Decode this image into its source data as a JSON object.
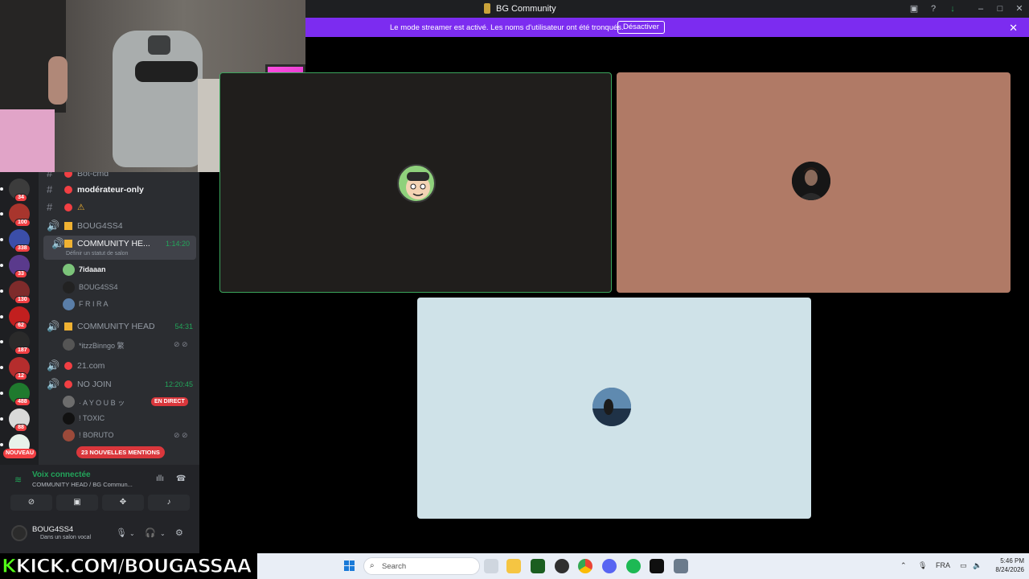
{
  "window": {
    "title": "BG Community"
  },
  "banner": {
    "message": "Le mode streamer est activé. Les noms d'utilisateur ont été tronqués.",
    "action_label": "Désactiver",
    "close_icon": "close-icon",
    "color": "#7c2cf0"
  },
  "servers": [
    {
      "badge": "34",
      "color": "#3c3c3c"
    },
    {
      "badge": "100",
      "color": "#a8352d"
    },
    {
      "badge": "338",
      "color": "#3b4ea8"
    },
    {
      "badge": "33",
      "color": "#5a3a8c"
    },
    {
      "badge": "130",
      "color": "#7e2b2b"
    },
    {
      "badge": "62",
      "color": "#c21f1f"
    },
    {
      "badge": "187",
      "color": "#2a2a2a"
    },
    {
      "badge": "12",
      "color": "#b52d2d"
    },
    {
      "badge": "488",
      "color": "#1f7a2e"
    },
    {
      "badge": "88",
      "color": "#d9d9d9"
    },
    {
      "badge": "",
      "color": "#e8f2ea"
    }
  ],
  "servers_new_label": "NOUVEAU",
  "channels": {
    "items": [
      {
        "name": "Bot-cmd",
        "icon": "hash"
      },
      {
        "name": "modérateur-only",
        "icon": "hash"
      },
      {
        "name": "⚠",
        "icon": "hash"
      },
      {
        "name": "BOUG4SS4",
        "icon": "speaker"
      },
      {
        "name": "COMMUNITY HE...",
        "icon": "speaker",
        "time": "1:14:20",
        "sub": "Définir un statut de salon"
      },
      {
        "name": "COMMUNITY HEAD",
        "icon": "speaker",
        "time": "54:31"
      },
      {
        "name": "21.com",
        "icon": "speaker"
      },
      {
        "name": "NO JOIN",
        "icon": "speaker",
        "time": "12:20:45"
      }
    ],
    "members_a": [
      "7idaaan",
      "BOUG4SS4",
      "F R I R A"
    ],
    "members_b": [
      "*itzzBinngo 繁"
    ],
    "members_c": [
      "· A Y O U B ッ",
      "! TOXIC",
      "! BORUTO"
    ],
    "live_label": "EN DIRECT",
    "mentions_label": "23 NOUVELLES MENTIONS"
  },
  "voice": {
    "status": "Voix connectée",
    "location": "COMMUNITY HEAD / BG Commun..."
  },
  "user": {
    "name": "BOUG4SS4",
    "status": "Dans un salon vocal"
  },
  "stream_overlay": {
    "kick_prefix": "K",
    "kick_rest": "KICK.COM/BOUGASSAA"
  },
  "taskbar": {
    "search_placeholder": "Search",
    "lang": "FRA",
    "time": "5:46 PM",
    "date": "8/24/2026"
  },
  "tiles": [
    {
      "bg": "#201e1c",
      "border": "#3ba55c",
      "speaking": true
    },
    {
      "bg": "#b07a66",
      "border": "",
      "speaking": false
    },
    {
      "bg": "#cfe2e8",
      "border": "",
      "speaking": false
    }
  ]
}
